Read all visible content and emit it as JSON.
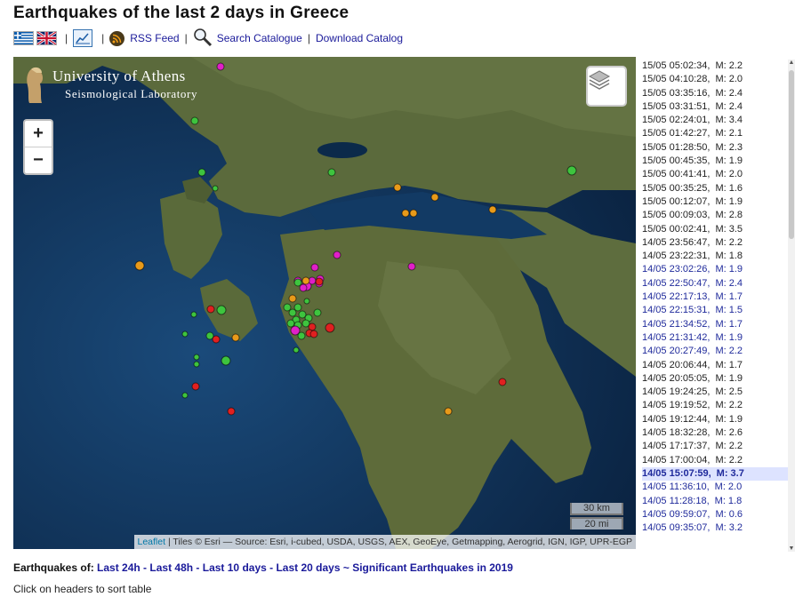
{
  "page_title": "Earthquakes of the last 2 days in Greece",
  "toolbar": {
    "rss_label": "RSS Feed",
    "search_label": "Search Catalogue",
    "download_label": "Download Catalog",
    "separator": "|"
  },
  "map": {
    "logo_name": "University of Athens",
    "logo_sub": "Seismological Laboratory",
    "zoom_in": "+",
    "zoom_out": "−",
    "scale_km": "30 km",
    "scale_mi": "20 mi",
    "attribution_link": "Leaflet",
    "attribution_text": " | Tiles © Esri — Source: Esri, i-cubed, USDA, USGS, AEX, GeoEye, Getmapping, Aerogrid, IGN, IGP, UPR-EGP",
    "colors": {
      "green": "#3ec43e",
      "red": "#e02020",
      "magenta": "#e020c8",
      "orange": "#e89a1a",
      "sea": "#0d2b4d",
      "land": "#5a6b3a"
    }
  },
  "quakes": [
    {
      "time": "15/05 05:02:34,",
      "mag": "M: 2.2",
      "style": "black"
    },
    {
      "time": "15/05 04:10:28,",
      "mag": "M: 2.0",
      "style": "black"
    },
    {
      "time": "15/05 03:35:16,",
      "mag": "M: 2.4",
      "style": "black"
    },
    {
      "time": "15/05 03:31:51,",
      "mag": "M: 2.4",
      "style": "black"
    },
    {
      "time": "15/05 02:24:01,",
      "mag": "M: 3.4",
      "style": "black"
    },
    {
      "time": "15/05 01:42:27,",
      "mag": "M: 2.1",
      "style": "black"
    },
    {
      "time": "15/05 01:28:50,",
      "mag": "M: 2.3",
      "style": "black"
    },
    {
      "time": "15/05 00:45:35,",
      "mag": "M: 1.9",
      "style": "black"
    },
    {
      "time": "15/05 00:41:41,",
      "mag": "M: 2.0",
      "style": "black"
    },
    {
      "time": "15/05 00:35:25,",
      "mag": "M: 1.6",
      "style": "black"
    },
    {
      "time": "15/05 00:12:07,",
      "mag": "M: 1.9",
      "style": "black"
    },
    {
      "time": "15/05 00:09:03,",
      "mag": "M: 2.8",
      "style": "black"
    },
    {
      "time": "15/05 00:02:41,",
      "mag": "M: 3.5",
      "style": "black"
    },
    {
      "time": "14/05 23:56:47,",
      "mag": "M: 2.2",
      "style": "black"
    },
    {
      "time": "14/05 23:22:31,",
      "mag": "M: 1.8",
      "style": "black"
    },
    {
      "time": "14/05 23:02:26,",
      "mag": "M: 1.9",
      "style": "blue"
    },
    {
      "time": "14/05 22:50:47,",
      "mag": "M: 2.4",
      "style": "blue"
    },
    {
      "time": "14/05 22:17:13,",
      "mag": "M: 1.7",
      "style": "blue"
    },
    {
      "time": "14/05 22:15:31,",
      "mag": "M: 1.5",
      "style": "blue"
    },
    {
      "time": "14/05 21:34:52,",
      "mag": "M: 1.7",
      "style": "blue"
    },
    {
      "time": "14/05 21:31:42,",
      "mag": "M: 1.9",
      "style": "blue"
    },
    {
      "time": "14/05 20:27:49,",
      "mag": "M: 2.2",
      "style": "blue"
    },
    {
      "time": "14/05 20:06:44,",
      "mag": "M: 1.7",
      "style": "black"
    },
    {
      "time": "14/05 20:05:05,",
      "mag": "M: 1.9",
      "style": "black"
    },
    {
      "time": "14/05 19:24:25,",
      "mag": "M: 2.5",
      "style": "black"
    },
    {
      "time": "14/05 19:19:52,",
      "mag": "M: 2.2",
      "style": "black"
    },
    {
      "time": "14/05 19:12:44,",
      "mag": "M: 1.9",
      "style": "black"
    },
    {
      "time": "14/05 18:32:28,",
      "mag": "M: 2.6",
      "style": "black"
    },
    {
      "time": "14/05 17:17:37,",
      "mag": "M: 2.2",
      "style": "black"
    },
    {
      "time": "14/05 17:00:04,",
      "mag": "M: 2.2",
      "style": "black"
    },
    {
      "time": "14/05 15:07:59,",
      "mag": "M: 3.7",
      "style": "hl"
    },
    {
      "time": "14/05 11:36:10,",
      "mag": "M: 2.0",
      "style": "blue"
    },
    {
      "time": "14/05 11:28:18,",
      "mag": "M: 1.8",
      "style": "blue"
    },
    {
      "time": "14/05 09:59:07,",
      "mag": "M: 0.6",
      "style": "blue"
    },
    {
      "time": "14/05 09:35:07,",
      "mag": "M: 3.2",
      "style": "blue"
    }
  ],
  "bottom": {
    "prefix": "Earthquakes of: ",
    "links": [
      "Last 24h",
      "Last 48h",
      "Last 10 days",
      "Last 20 days"
    ],
    "dash": " - ",
    "tilde": " ~ ",
    "significant": "Significant Earthquakes in 2019",
    "hint": "Click on headers to sort table"
  }
}
